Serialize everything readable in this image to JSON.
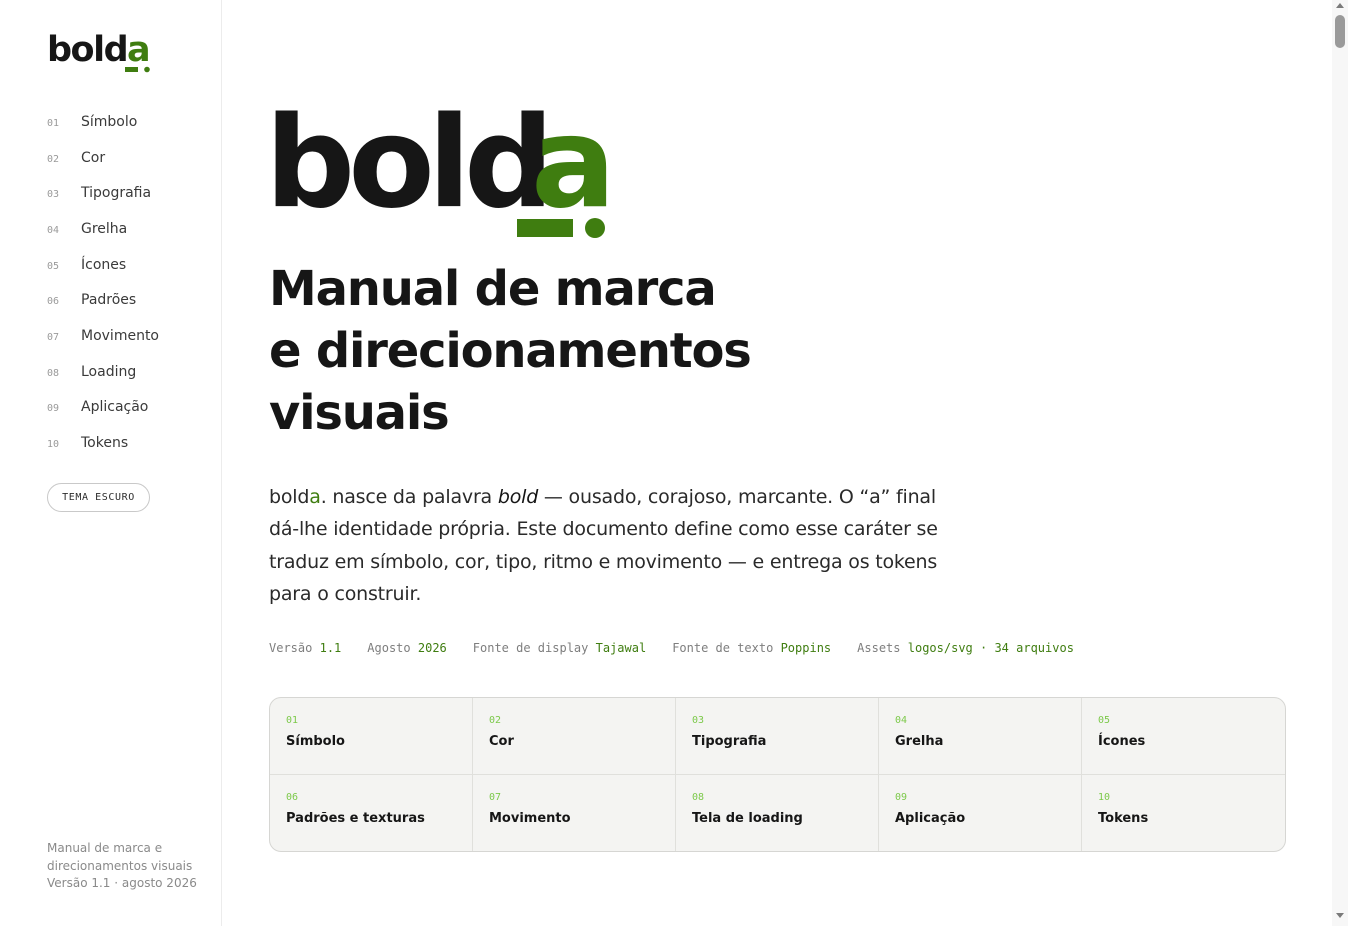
{
  "brand": {
    "name_prefix": "bold",
    "name_suffix": "a",
    "accent_color": "#3f7d10",
    "accent_light": "#7cc94a",
    "ink_color": "#161616"
  },
  "sidebar": {
    "items": [
      {
        "num": "01",
        "label": "Símbolo"
      },
      {
        "num": "02",
        "label": "Cor"
      },
      {
        "num": "03",
        "label": "Tipografia"
      },
      {
        "num": "04",
        "label": "Grelha"
      },
      {
        "num": "05",
        "label": "Ícones"
      },
      {
        "num": "06",
        "label": "Padrões"
      },
      {
        "num": "07",
        "label": "Movimento"
      },
      {
        "num": "08",
        "label": "Loading"
      },
      {
        "num": "09",
        "label": "Aplicação"
      },
      {
        "num": "10",
        "label": "Tokens"
      }
    ],
    "theme_button": "TEMA ESCURO",
    "footer_line1": "Manual de marca e",
    "footer_line2": "direcionamentos visuais",
    "footer_line3": "Versão 1.1 · agosto 2026"
  },
  "main": {
    "headline_line1": "Manual de marca",
    "headline_line2": "e direcionamentos",
    "headline_line3": "visuais",
    "intro": {
      "brand_a": "bold",
      "brand_b": "a",
      "part1": ". nasce da palavra ",
      "em": "bold",
      "part2": " — ousado, corajoso, marcante. O “a” final dá-lhe identidade própria. Este documento define como esse caráter se traduz em símbolo, cor, tipo, ritmo e movimento — e entrega os tokens para o construir."
    },
    "meta": [
      {
        "label": "Versão",
        "value": "1.1"
      },
      {
        "label": "Agosto",
        "value": "2026"
      },
      {
        "label": "Fonte de display",
        "value": "Tajawal"
      },
      {
        "label": "Fonte de texto",
        "value": "Poppins"
      },
      {
        "label": "Assets",
        "value": "logos/svg · 34 arquivos"
      }
    ],
    "sections": [
      {
        "num": "01",
        "title": "Símbolo"
      },
      {
        "num": "02",
        "title": "Cor"
      },
      {
        "num": "03",
        "title": "Tipografia"
      },
      {
        "num": "04",
        "title": "Grelha"
      },
      {
        "num": "05",
        "title": "Ícones"
      },
      {
        "num": "06",
        "title": "Padrões e texturas"
      },
      {
        "num": "07",
        "title": "Movimento"
      },
      {
        "num": "08",
        "title": "Tela de loading"
      },
      {
        "num": "09",
        "title": "Aplicação"
      },
      {
        "num": "10",
        "title": "Tokens"
      }
    ]
  }
}
